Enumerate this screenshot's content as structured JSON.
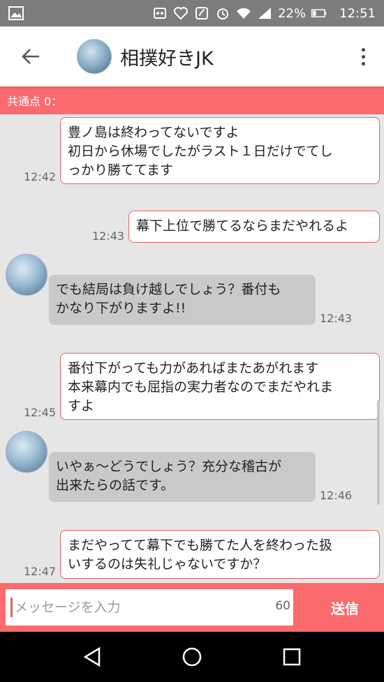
{
  "status_bar": {
    "battery": "22%",
    "time": "12:51"
  },
  "header": {
    "title": "相撲好きJK"
  },
  "common_bar": {
    "label": "共通点 0："
  },
  "messages": [
    {
      "dir": "out",
      "text": "豊ノ島は終わってないですよ\n初日から休場でしたがラスト１日だけでてし\nっかり勝ててます",
      "time": "12:42"
    },
    {
      "dir": "out",
      "text": "幕下上位で勝てるならまだやれるよ",
      "time": "12:43"
    },
    {
      "dir": "in",
      "text": "でも結局は負け越しでしょう？番付も\nかなり下がりますよ!!",
      "time": "12:43"
    },
    {
      "dir": "out",
      "text": "番付下がっても力があればまたあがれます\n本来幕内でも屈指の実力者なのでまだやれま\nすよ",
      "time": "12:45"
    },
    {
      "dir": "in",
      "text": "いやぁ～どうでしょう？充分な稽古が\n出来たらの話です。",
      "time": "12:46"
    },
    {
      "dir": "out",
      "text": "まだやってて幕下でも勝てた人を終わった扱\nいするのは失礼じゃないですか？",
      "time": "12:47"
    }
  ],
  "input": {
    "placeholder": "メッセージを入力",
    "counter": "60",
    "send_label": "送信"
  },
  "colors": {
    "accent": "#fb6b6d",
    "bubble_border": "#e9605e",
    "incoming_bubble": "#c9c9c9",
    "chat_background": "#e6e6e6"
  }
}
